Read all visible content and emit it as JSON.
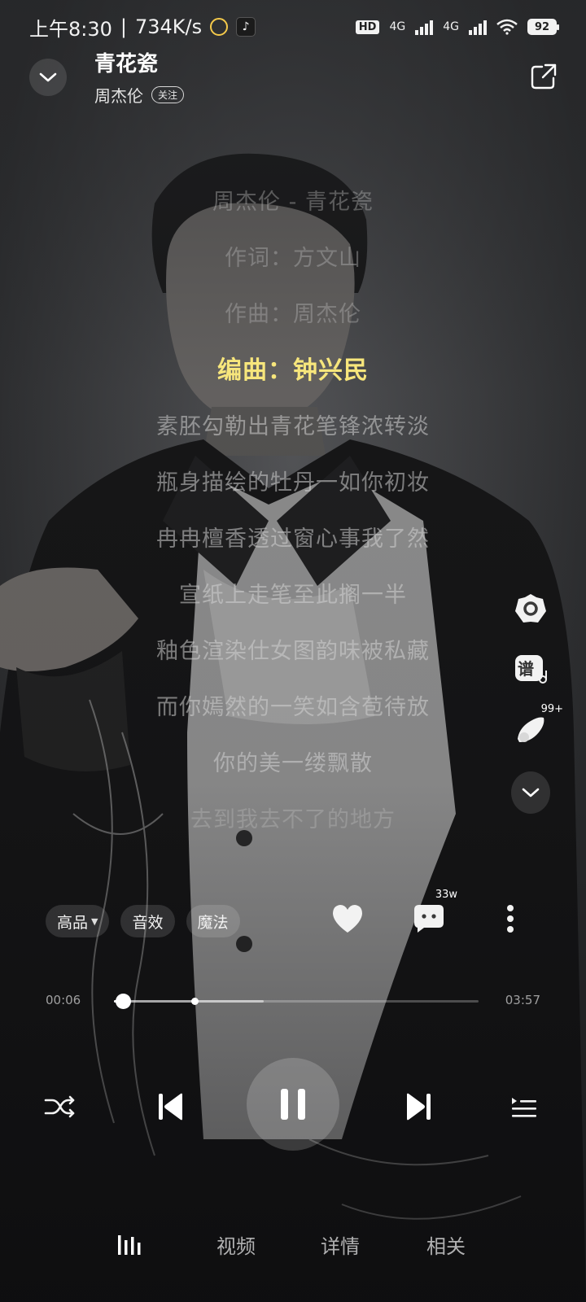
{
  "status_bar": {
    "time": "上午8:30",
    "speed": "734K/s",
    "network_1": "4G",
    "network_2": "4G",
    "hd": "HD",
    "battery": "92"
  },
  "header": {
    "title": "青花瓷",
    "artist": "周杰伦",
    "follow_label": "关注"
  },
  "lyrics": [
    "周杰伦 - 青花瓷",
    "作词：方文山",
    "作曲：周杰伦",
    "编曲：钟兴民",
    "素胚勾勒出青花笔锋浓转淡",
    "瓶身描绘的牡丹一如你初妆",
    "冉冉檀香透过窗心事我了然",
    "宣纸上走笔至此搁一半",
    "釉色渲染仕女图韵味被私藏",
    "而你嫣然的一笑如含苞待放",
    "你的美一缕飘散",
    "去到我去不了的地方"
  ],
  "active_lyric_index": 3,
  "side_tools": {
    "score_label": "谱",
    "comments_badge": "99+"
  },
  "quality_row": {
    "quality_label": "高品",
    "effect_label": "音效",
    "magic_label": "魔法"
  },
  "actions": {
    "comment_count": "33w"
  },
  "progress": {
    "current": "00:06",
    "total": "03:57",
    "played_fraction": 0.025,
    "buffered_fraction": 0.41,
    "marker_fraction": 0.22
  },
  "tabs": {
    "video": "视频",
    "detail": "详情",
    "related": "相关"
  },
  "colors": {
    "active_lyric": "#f7e67c",
    "background": "#2f3032"
  }
}
